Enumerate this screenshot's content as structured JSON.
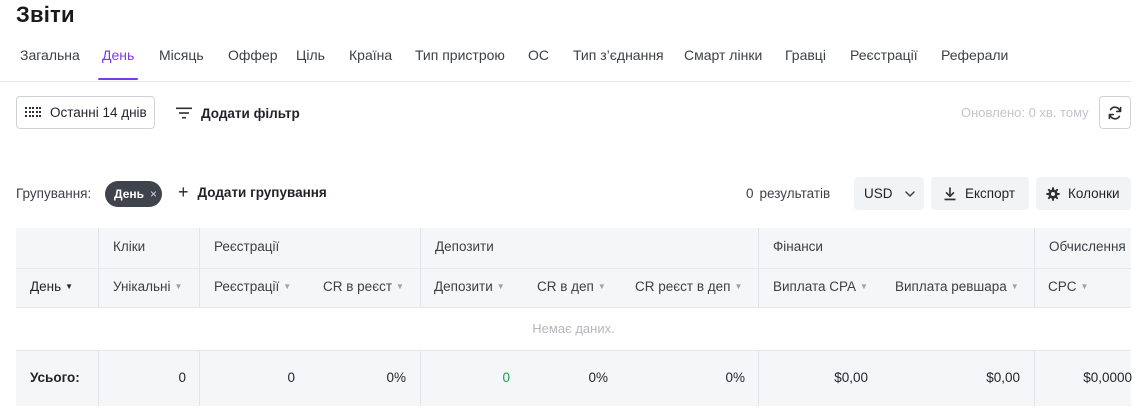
{
  "page": {
    "title": "Звіти"
  },
  "tabs": [
    {
      "label": "Загальна",
      "active": false
    },
    {
      "label": "День",
      "active": true
    },
    {
      "label": "Місяць",
      "active": false
    },
    {
      "label": "Оффер",
      "active": false
    },
    {
      "label": "Ціль",
      "active": false
    },
    {
      "label": "Країна",
      "active": false
    },
    {
      "label": "Тип пристрою",
      "active": false
    },
    {
      "label": "ОС",
      "active": false
    },
    {
      "label": "Тип з’єднання",
      "active": false
    },
    {
      "label": "Смарт лінки",
      "active": false
    },
    {
      "label": "Гравці",
      "active": false
    },
    {
      "label": "Реєстрації",
      "active": false
    },
    {
      "label": "Реферали",
      "active": false
    }
  ],
  "toolbar": {
    "date_range_label": "Останні 14 днів",
    "date_range_icon": "grid-calendar-icon",
    "add_filter_label": "Додати фільтр",
    "add_filter_icon": "filter-lines-icon",
    "updated_text": "Оновлено: 0 хв. тому",
    "refresh_icon": "refresh-icon"
  },
  "grouping": {
    "label": "Групування:",
    "chip_label": "День",
    "chip_remove": "×",
    "add_label": "Додати групування"
  },
  "results": {
    "count": "0",
    "label": "результатів"
  },
  "actions": {
    "currency": "USD",
    "export_label": "Експорт",
    "columns_label": "Колонки"
  },
  "table": {
    "groups": [
      "Кліки",
      "Реєстрації",
      "Депозити",
      "Фінанси",
      "Обчислення"
    ],
    "columns": [
      "День",
      "Унікальні",
      "Реєстрації",
      "CR в реєст",
      "Депозити",
      "CR в деп",
      "CR реєст в деп",
      "Виплата CPA",
      "Виплата ревшара",
      "CPC"
    ],
    "empty_text": "Немає даних.",
    "total_label": "Усього:",
    "totals": [
      "0",
      "0",
      "0%",
      "0",
      "0%",
      "0%",
      "$0,00",
      "$0,00",
      "$0,0000"
    ]
  },
  "colors": {
    "accent": "#7c3aed",
    "positive": "#16a34a",
    "chip": "#3f434b"
  }
}
